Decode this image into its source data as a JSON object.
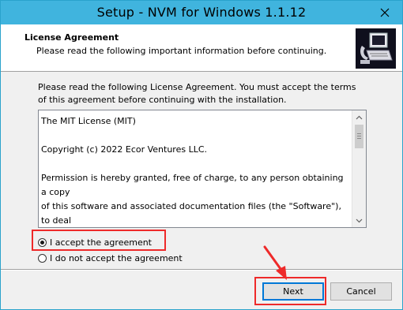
{
  "window": {
    "title": "Setup - NVM for Windows 1.1.12"
  },
  "colors": {
    "titlebar": "#40b4de",
    "annotation_red": "#ee2a2a",
    "focus_blue": "#0078d7"
  },
  "header": {
    "title": "License Agreement",
    "subtitle": "Please read the following important information before continuing.",
    "logo_icon": "computer-setup-icon"
  },
  "main": {
    "intro": "Please read the following License Agreement. You must accept the terms of this agreement before continuing with the installation.",
    "license_text": "The MIT License (MIT)\n\nCopyright (c) 2022 Ecor Ventures LLC.\n\nPermission is hereby granted, free of charge, to any person obtaining a copy\nof this software and associated documentation files (the \"Software\"), to deal\nin the Software without restriction, including without limitation the rights\nto use, copy, modify, merge, publish, distribute, sublicense, and/or sell\ncopies of the Software, and to permit persons to whom the Software is\nfurnished to do so, subject to the following conditions:",
    "options": {
      "accept": "I accept the agreement",
      "decline": "I do not accept the agreement",
      "selected": "accept"
    }
  },
  "footer": {
    "next_label": "Next",
    "cancel_label": "Cancel"
  }
}
